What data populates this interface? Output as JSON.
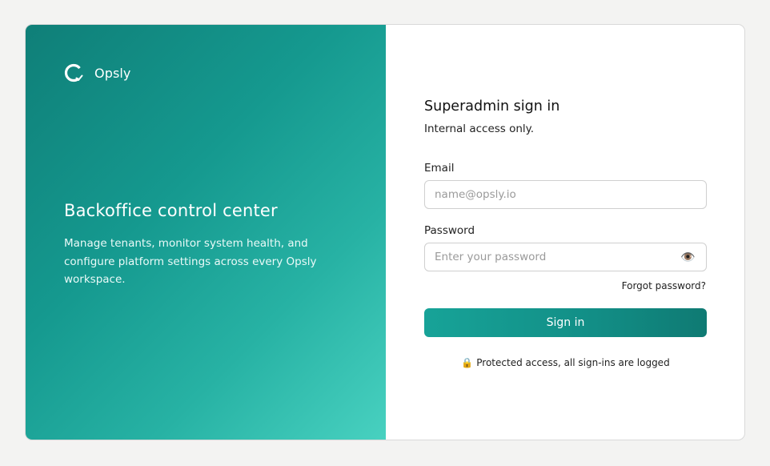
{
  "brand": {
    "name": "Opsly",
    "logo_icon": "opsly-logo-icon"
  },
  "hero": {
    "title": "Backoffice control center",
    "description": "Manage tenants, monitor system health, and configure platform settings across every Opsly workspace.",
    "gradient_colors": [
      "#0f7f78",
      "#15998f",
      "#48d1c0"
    ]
  },
  "form": {
    "title": "Superadmin sign in",
    "subtitle": "Internal access only.",
    "email": {
      "label": "Email",
      "placeholder": "name@opsly.io",
      "value": ""
    },
    "password": {
      "label": "Password",
      "placeholder": "Enter your password",
      "value": "",
      "toggle_icon": "eye-icon"
    },
    "forgot_label": "Forgot password?",
    "submit_label": "Sign in",
    "notice": "Protected access, all sign-ins are logged",
    "notice_icon": "lock-icon"
  },
  "colors": {
    "accent": "#128e86",
    "page_background": "#f3f3f2"
  }
}
